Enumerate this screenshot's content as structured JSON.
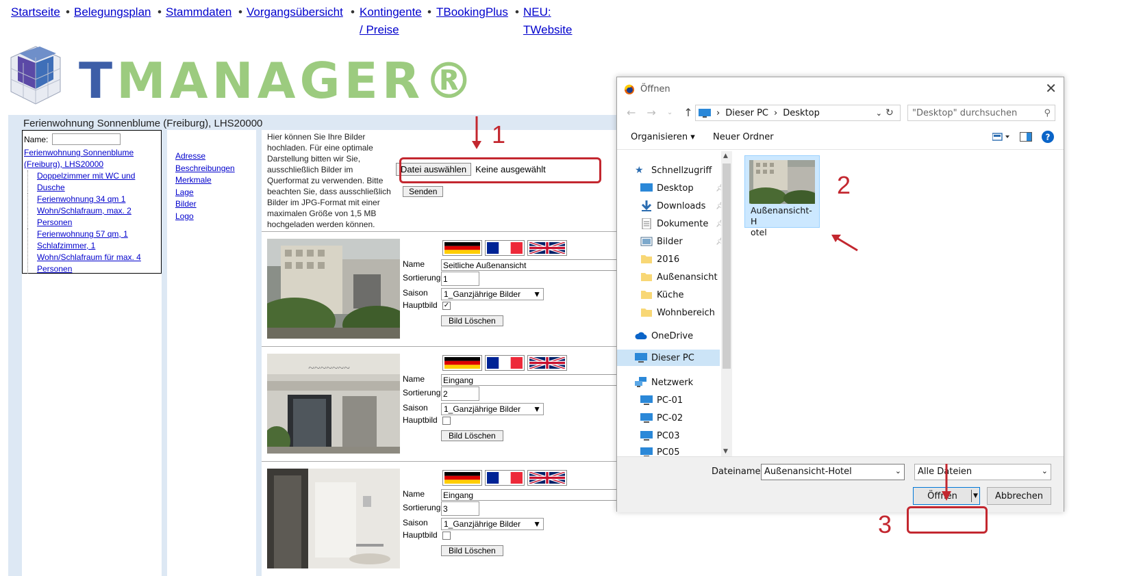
{
  "nav": {
    "items": [
      {
        "label": "Startseite"
      },
      {
        "label": "Belegungsplan"
      },
      {
        "label": "Stammdaten"
      },
      {
        "label": "Vorgangsübersicht"
      },
      {
        "label": "Kontingente",
        "label2": "/ Preise"
      },
      {
        "label": "TBookingPlus"
      },
      {
        "label": "NEU:",
        "label2": "TWebsite"
      }
    ],
    "separator": "•"
  },
  "logo": {
    "t": "T",
    "rest": "MANAGER®"
  },
  "panel": {
    "title": "Ferienwohnung Sonnenblume (Freiburg), LHS20000"
  },
  "tree": {
    "name_label": "Name:",
    "root": [
      "Ferienwohnung Sonnenblume",
      "(Freiburg), LHS20000"
    ],
    "children": [
      [
        "Doppelzimmer mit WC und",
        "Dusche"
      ],
      [
        "Ferienwohnung 34 qm 1",
        "Wohn/Schlafraum, max. 2",
        "Personen"
      ],
      [
        "Ferienwohnung 57 qm, 1",
        "Schlafzimmer, 1",
        "Wohn/Schlafraum für max. 4",
        "Personen"
      ]
    ]
  },
  "menu": [
    "Adresse",
    "Beschreibungen",
    "Merkmale",
    "Lage",
    "Bilder",
    "Logo"
  ],
  "upload": {
    "intro": "Hier können Sie Ihre Bilder hochladen. Für eine optimale Darstellung bitten wir Sie, ausschließlich Bilder im Querformat zu verwenden. Bitte beachten Sie, dass ausschließlich Bilder im JPG-Format mit einer maximalen Größe von 1,5 MB hochgeladen werden können.",
    "choose_button": "Datei auswählen",
    "none_selected": "Keine ausgewählt",
    "send_button": "Senden"
  },
  "entry_labels": {
    "name": "Name",
    "sort": "Sortierung",
    "season": "Saison",
    "main": "Hauptbild",
    "delete": "Bild Löschen"
  },
  "entries": [
    {
      "name": "Seitliche Außenansicht",
      "sort": "1",
      "season": "1_Ganzjährige Bilder",
      "main": true
    },
    {
      "name": "Eingang",
      "sort": "2",
      "season": "1_Ganzjährige Bilder",
      "main": false
    },
    {
      "name": "Eingang",
      "sort": "3",
      "season": "1_Ganzjährige Bilder",
      "main": false
    }
  ],
  "annotations": {
    "a1": "1",
    "a2": "2",
    "a3": "3"
  },
  "dialog": {
    "title": "Öffnen",
    "breadcrumb": [
      "Dieser PC",
      "Desktop"
    ],
    "search_placeholder": "\"Desktop\" durchsuchen",
    "organize": "Organisieren",
    "new_folder": "Neuer Ordner",
    "nav": [
      {
        "label": "Schnellzugriff",
        "icon": "star-icon"
      },
      {
        "label": "Desktop",
        "icon": "desktop-icon",
        "pinned": true
      },
      {
        "label": "Downloads",
        "icon": "download-icon",
        "pinned": true
      },
      {
        "label": "Dokumente",
        "icon": "document-icon",
        "pinned": true
      },
      {
        "label": "Bilder",
        "icon": "pictures-icon",
        "pinned": true
      },
      {
        "label": "2016",
        "icon": "folder-icon"
      },
      {
        "label": "Außenansicht",
        "icon": "folder-icon"
      },
      {
        "label": "Küche",
        "icon": "folder-icon"
      },
      {
        "label": "Wohnbereich",
        "icon": "folder-icon"
      },
      {
        "label": "OneDrive",
        "icon": "cloud-icon"
      },
      {
        "label": "Dieser PC",
        "icon": "computer-icon"
      },
      {
        "label": "Netzwerk",
        "icon": "network-icon"
      },
      {
        "label": "PC-01",
        "icon": "computer-icon"
      },
      {
        "label": "PC-02",
        "icon": "computer-icon"
      },
      {
        "label": "PC03",
        "icon": "computer-icon"
      },
      {
        "label": "PC05",
        "icon": "computer-icon"
      }
    ],
    "file": {
      "name_line1": "Außenansicht-H",
      "name_line2": "otel"
    },
    "filename_label": "Dateiname:",
    "filename_value": "Außenansicht-Hotel",
    "filetype": "Alle Dateien",
    "open_button": "Öffnen",
    "cancel_button": "Abbrechen"
  },
  "colors": {
    "annotation": "#c3272f",
    "link": "#0000cc",
    "panel_bg": "#dde8f4",
    "logo_blue": "#3d5ea7",
    "logo_green": "#9ccb7f"
  }
}
